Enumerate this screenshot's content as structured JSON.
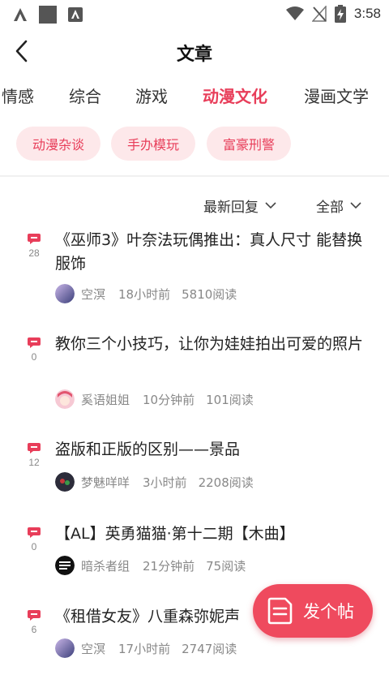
{
  "status_bar": {
    "time": "3:58",
    "icons": [
      "signal-a-icon",
      "app-square-icon",
      "app-a-icon",
      "wifi-icon",
      "no-signal-icon",
      "battery-charging-icon"
    ]
  },
  "header": {
    "title": "文章",
    "back_icon": "chevron-left-icon"
  },
  "tabs": [
    {
      "label": "情感",
      "active": false
    },
    {
      "label": "综合",
      "active": false
    },
    {
      "label": "游戏",
      "active": false
    },
    {
      "label": "动漫文化",
      "active": true
    },
    {
      "label": "漫画文学",
      "active": false
    }
  ],
  "chips": [
    {
      "label": "动漫杂谈"
    },
    {
      "label": "手办模玩"
    },
    {
      "label": "富豪刑警"
    }
  ],
  "filters": {
    "sort": "最新回复",
    "scope": "全部"
  },
  "posts": [
    {
      "title": "《巫师3》叶奈法玩偶推出：真人尺寸 能替换服饰",
      "comments": "28",
      "author": "空溟",
      "time": "18小时前",
      "reads": "5810阅读"
    },
    {
      "title": "教你三个小技巧，让你为娃娃拍出可爱的照片",
      "comments": "0",
      "author": "奚语姐姐",
      "time": "10分钟前",
      "reads": "101阅读"
    },
    {
      "title": "盗版和正版的区别——景品",
      "comments": "12",
      "author": "梦魅咩咩",
      "time": "3小时前",
      "reads": "2208阅读"
    },
    {
      "title": "【AL】英勇猫猫·第十二期【木曲】",
      "comments": "0",
      "author": "暗杀者组",
      "time": "21分钟前",
      "reads": "75阅读"
    },
    {
      "title": "《租借女友》八重森弥妮声",
      "comments": "6",
      "author": "空溟",
      "time": "17小时前",
      "reads": "2747阅读"
    }
  ],
  "fab": {
    "label": "发个帖",
    "icon": "note-icon"
  },
  "colors": {
    "accent": "#e83e5a",
    "chip_bg": "#fde8ea",
    "fab_bg": "#ef4a5e"
  }
}
